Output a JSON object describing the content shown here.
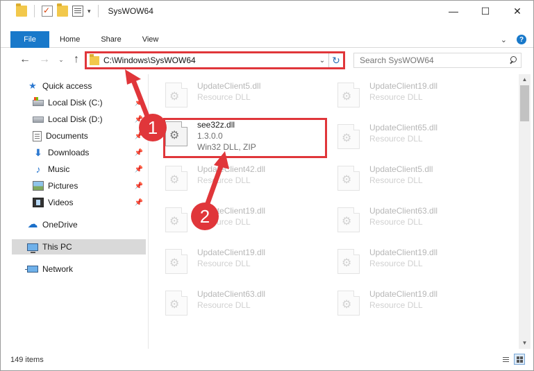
{
  "window": {
    "title": "SysWOW64",
    "controls": {
      "minimize": "—",
      "maximize": "☐",
      "close": "✕"
    }
  },
  "ribbon": {
    "file_tab": "File",
    "tabs": [
      "Home",
      "Share",
      "View"
    ],
    "expand_glyph": "⌄",
    "help_glyph": "?"
  },
  "nav": {
    "back": "←",
    "forward": "→",
    "recent": "⌄",
    "up": "↑"
  },
  "address": {
    "path": "C:\\Windows\\SysWOW64",
    "dropdown": "⌄",
    "refresh": "↻"
  },
  "search": {
    "placeholder": "Search SysWOW64"
  },
  "sidebar": {
    "items": [
      {
        "label": "Quick access",
        "icon": "star-icon",
        "pinned": false
      },
      {
        "label": "Local Disk (C:)",
        "icon": "windows-drive-icon",
        "pinned": true
      },
      {
        "label": "Local Disk (D:)",
        "icon": "drive-icon",
        "pinned": true
      },
      {
        "label": "Documents",
        "icon": "document-icon",
        "pinned": true
      },
      {
        "label": "Downloads",
        "icon": "download-icon",
        "pinned": true
      },
      {
        "label": "Music",
        "icon": "music-icon",
        "pinned": true
      },
      {
        "label": "Pictures",
        "icon": "pictures-icon",
        "pinned": true
      },
      {
        "label": "Videos",
        "icon": "videos-icon",
        "pinned": true
      },
      {
        "label": "OneDrive",
        "icon": "cloud-icon",
        "pinned": false
      },
      {
        "label": "This PC",
        "icon": "computer-icon",
        "pinned": false,
        "selected": true
      },
      {
        "label": "Network",
        "icon": "network-icon",
        "pinned": false
      }
    ],
    "pin_glyph": "📌"
  },
  "files": {
    "left_column": [
      {
        "name": "UpdateClient5.dll",
        "type": "Resource DLL"
      },
      {
        "name": "see32z.dll",
        "version": "1.3.0.0",
        "type": "Win32 DLL, ZIP",
        "highlighted": true
      },
      {
        "name": "UpdateClient42.dll",
        "type": "Resource DLL"
      },
      {
        "name": "UpdateClient19.dll",
        "type": "Resource DLL"
      },
      {
        "name": "UpdateClient19.dll",
        "type": "Resource DLL"
      },
      {
        "name": "UpdateClient63.dll",
        "type": "Resource DLL"
      }
    ],
    "right_column": [
      {
        "name": "UpdateClient19.dll",
        "type": "Resource DLL"
      },
      {
        "name": "UpdateClient65.dll",
        "type": "Resource DLL"
      },
      {
        "name": "UpdateClient5.dll",
        "type": "Resource DLL"
      },
      {
        "name": "UpdateClient63.dll",
        "type": "Resource DLL"
      },
      {
        "name": "UpdateClient19.dll",
        "type": "Resource DLL"
      },
      {
        "name": "UpdateClient19.dll",
        "type": "Resource DLL"
      }
    ]
  },
  "status": {
    "item_count": "149 items"
  },
  "annotations": {
    "step1": "1",
    "step2": "2",
    "arrow_color": "#e0363a"
  }
}
